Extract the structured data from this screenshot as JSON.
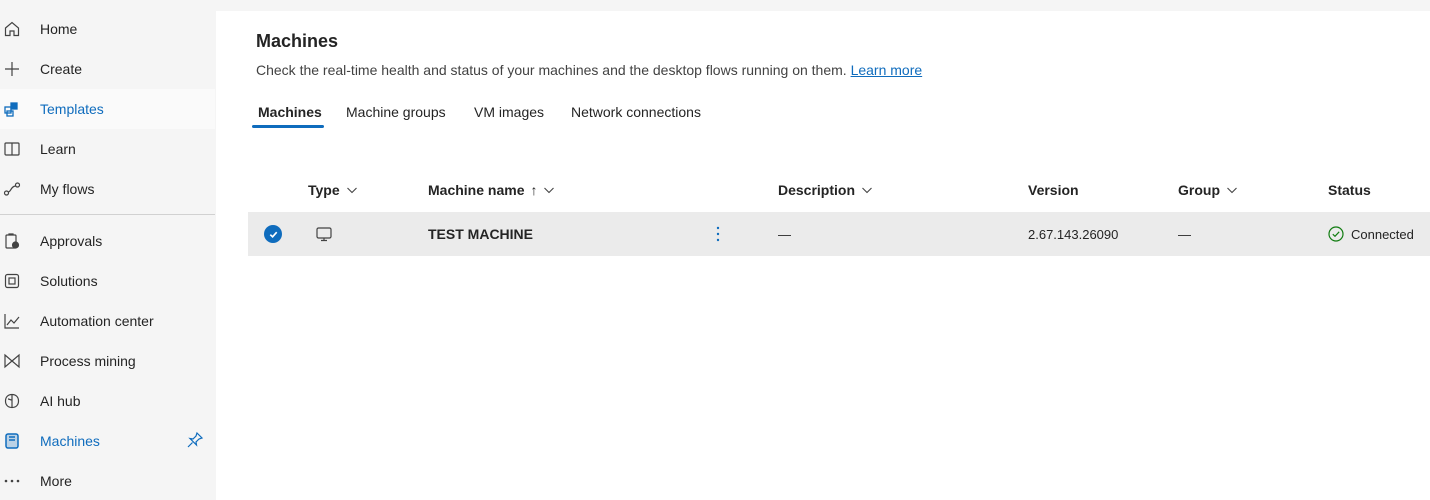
{
  "sidebar": {
    "items": [
      {
        "label": "Home",
        "icon": "home-icon"
      },
      {
        "label": "Create",
        "icon": "plus-icon"
      },
      {
        "label": "Templates",
        "icon": "templates-icon"
      },
      {
        "label": "Learn",
        "icon": "book-icon"
      },
      {
        "label": "My flows",
        "icon": "flow-icon"
      },
      {
        "label": "Approvals",
        "icon": "approvals-icon"
      },
      {
        "label": "Solutions",
        "icon": "solutions-icon"
      },
      {
        "label": "Automation center",
        "icon": "chart-line-icon"
      },
      {
        "label": "Process mining",
        "icon": "process-mining-icon"
      },
      {
        "label": "AI hub",
        "icon": "brain-icon"
      },
      {
        "label": "Machines",
        "icon": "machine-icon"
      },
      {
        "label": "More",
        "icon": "more-icon"
      }
    ]
  },
  "main": {
    "title": "Machines",
    "description": "Check the real-time health and status of your machines and the desktop flows running on them.",
    "learn_more": "Learn more",
    "tabs": [
      {
        "label": "Machines",
        "active": true
      },
      {
        "label": "Machine groups",
        "active": false
      },
      {
        "label": "VM images",
        "active": false
      },
      {
        "label": "Network connections",
        "active": false
      }
    ],
    "table": {
      "headers": {
        "type": "Type",
        "machine_name": "Machine name",
        "sort_arrow": "↑",
        "description": "Description",
        "version": "Version",
        "group": "Group",
        "status": "Status"
      },
      "rows": [
        {
          "machine_name": "TEST MACHINE",
          "description": "—",
          "version": "2.67.143.26090",
          "group": "—",
          "status": "Connected"
        }
      ]
    }
  },
  "colors": {
    "accent": "#0f6cbd",
    "success": "#107c10",
    "row_selected": "#ebebeb"
  }
}
